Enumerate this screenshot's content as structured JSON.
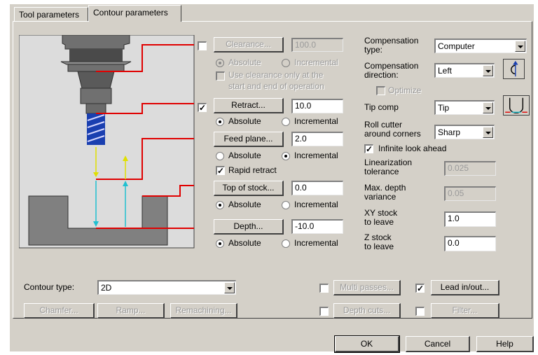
{
  "tabs": [
    "Tool parameters",
    "Contour parameters"
  ],
  "heights": {
    "clearance": {
      "label": "Clearance...",
      "value": "100.0",
      "absolute": "Absolute",
      "incremental": "Incremental",
      "use_clearance": "Use clearance only at the",
      "use_clearance_2": "start and end of operation"
    },
    "retract": {
      "label": "Retract...",
      "value": "10.0",
      "absolute": "Absolute",
      "incremental": "Incremental"
    },
    "feed_plane": {
      "label": "Feed plane...",
      "value": "2.0",
      "absolute": "Absolute",
      "incremental": "Incremental"
    },
    "rapid_retract": "Rapid retract",
    "top_of_stock": {
      "label": "Top of stock...",
      "value": "0.0",
      "absolute": "Absolute",
      "incremental": "Incremental"
    },
    "depth": {
      "label": "Depth...",
      "value": "-10.0",
      "absolute": "Absolute",
      "incremental": "Incremental"
    }
  },
  "compensation": {
    "type_label": "Compensation type:",
    "type_value": "Computer",
    "direction_label": "Compensation direction:",
    "direction_value": "Left",
    "optimize": "Optimize",
    "tip_comp_label": "Tip comp",
    "tip_comp_value": "Tip",
    "roll_label_1": "Roll cutter",
    "roll_label_2": "around corners",
    "roll_value": "Sharp",
    "infinite": "Infinite look ahead",
    "lin_label_1": "Linearization",
    "lin_label_2": "tolerance",
    "lin_value": "0.025",
    "maxdepth_label_1": "Max. depth",
    "maxdepth_label_2": "variance",
    "maxdepth_value": "0.05",
    "xy_label_1": "XY stock",
    "xy_label_2": "to leave",
    "xy_value": "1.0",
    "z_label_1": "Z stock",
    "z_label_2": "to leave",
    "z_value": "0.0"
  },
  "bottom": {
    "contour_type_label": "Contour type:",
    "contour_type_value": "2D",
    "chamfer": "Chamfer...",
    "ramp": "Ramp...",
    "remachining": "Remachining...",
    "multi_passes": "Multi passes...",
    "depth_cuts": "Depth cuts...",
    "lead_inout": "Lead in/out...",
    "filter": "Filter..."
  },
  "footer": {
    "ok": "OK",
    "cancel": "Cancel",
    "help": "Help"
  },
  "colors": {
    "dialog_bg": "#d4d0c8",
    "guide_line": "#e00000",
    "tool_blue": "#1a3fb0",
    "rapid": "#e0e000",
    "feed": "#20c0d0"
  }
}
